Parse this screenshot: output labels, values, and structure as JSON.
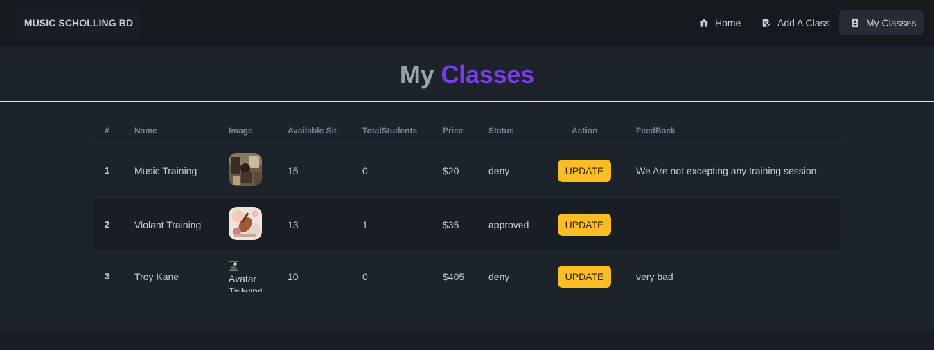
{
  "nav": {
    "brand": "MUSIC SCHOLLING BD",
    "items": [
      {
        "label": "Home",
        "icon": "home-icon"
      },
      {
        "label": "Add A Class",
        "icon": "edit-document-icon"
      },
      {
        "label": "My Classes",
        "icon": "contact-card-icon",
        "active": true
      }
    ]
  },
  "page": {
    "title_part1": "My",
    "title_part2": "Classes"
  },
  "table": {
    "headers": [
      "#",
      "Name",
      "Image",
      "Available Sit",
      "TotalStudents",
      "Price",
      "Status",
      "Action",
      "FeedBack"
    ],
    "rows": [
      {
        "index": "1",
        "name": "Music Training",
        "image": "music-training-thumbnail",
        "available": "15",
        "students": "0",
        "price": "$20",
        "status": "deny",
        "action": "UPDATE",
        "feedback": "We Are not excepting any training session."
      },
      {
        "index": "2",
        "name": "Violant Training",
        "image": "violin-training-thumbnail",
        "available": "13",
        "students": "1",
        "price": "$35",
        "status": "approved",
        "action": "UPDATE",
        "feedback": ""
      },
      {
        "index": "3",
        "name": "Troy Kane",
        "image_alt": "Avatar Tailwind",
        "available": "10",
        "students": "0",
        "price": "$405",
        "status": "deny",
        "action": "UPDATE",
        "feedback": "very bad"
      }
    ]
  },
  "colors": {
    "accent": "#7c3aed",
    "button": "#fbbd23",
    "background": "#1d232a",
    "navbar": "#161a1f"
  }
}
